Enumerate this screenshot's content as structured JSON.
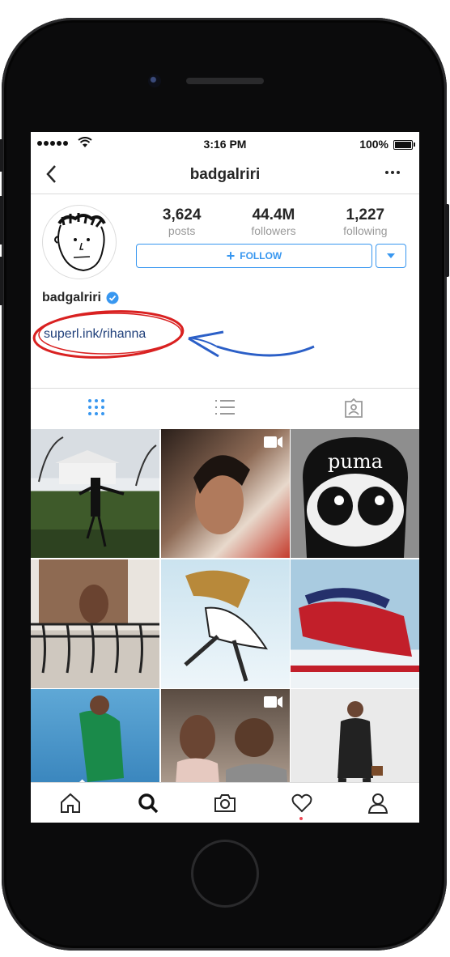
{
  "status_bar": {
    "time": "3:16 PM",
    "battery": "100%"
  },
  "header": {
    "title": "badgalriri"
  },
  "profile": {
    "stats": [
      {
        "value": "3,624",
        "label": "posts"
      },
      {
        "value": "44.4M",
        "label": "followers"
      },
      {
        "value": "1,227",
        "label": "following"
      }
    ],
    "follow_label": "FOLLOW",
    "username": "badgalriri",
    "link": "superl.ink/rihanna",
    "avatar_icon": "doodle-face-icon"
  },
  "tabs": [
    "grid-view-icon",
    "list-view-icon",
    "tagged-photos-icon"
  ],
  "tabbar": [
    "home-icon",
    "search-icon",
    "camera-icon",
    "heart-icon",
    "profile-icon"
  ],
  "photos": [
    {
      "label": "white-house-photo"
    },
    {
      "label": "portrait-video",
      "video": true
    },
    {
      "label": "puma-cartoon-photo",
      "caption": "puma"
    },
    {
      "label": "balcony-photo"
    },
    {
      "label": "fashion-jump-photo"
    },
    {
      "label": "sled-ad-photo"
    },
    {
      "label": "beach-sport-photo"
    },
    {
      "label": "party-video",
      "video": true
    },
    {
      "label": "street-style-photo"
    }
  ],
  "colors": {
    "accent": "#3897f0",
    "annotation_red": "#d92121",
    "annotation_blue": "#2b5fc7"
  }
}
